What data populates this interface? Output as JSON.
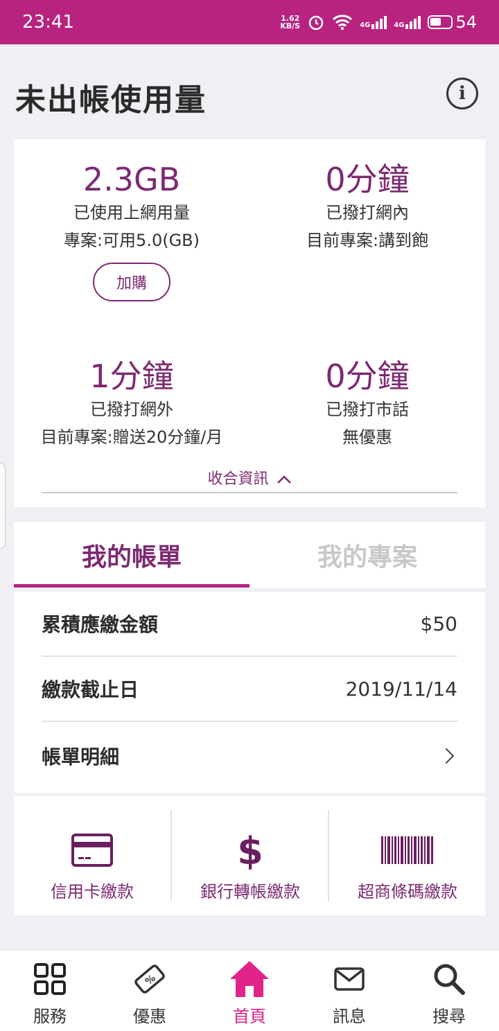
{
  "status_bar": {
    "time": "23:41",
    "net_speed_value": "1.62",
    "net_speed_unit": "KB/S",
    "signal1": "4G",
    "signal2": "4G",
    "battery": "54"
  },
  "page": {
    "title": "未出帳使用量"
  },
  "usage": {
    "data": {
      "amount": "2.3GB",
      "label": "已使用上網用量",
      "plan": "專案:可用5.0(GB)",
      "addon_button": "加購"
    },
    "onnet": {
      "amount": "0分鐘",
      "label": "已撥打網內",
      "plan": "目前專案:講到飽"
    },
    "offnet": {
      "amount": "1分鐘",
      "label": "已撥打網外",
      "plan": "目前專案:贈送20分鐘/月"
    },
    "landline": {
      "amount": "0分鐘",
      "label": "已撥打市話",
      "plan": "無優惠"
    },
    "collapse_label": "收合資訊"
  },
  "tabs": [
    {
      "label": "我的帳單",
      "active": true
    },
    {
      "label": "我的專案",
      "active": false
    }
  ],
  "bill": {
    "rows": [
      {
        "label": "累積應繳金額",
        "value": "$50"
      },
      {
        "label": "繳款截止日",
        "value": "2019/11/14"
      },
      {
        "label": "帳單明細",
        "value": ""
      }
    ]
  },
  "payment": [
    {
      "label": "信用卡繳款",
      "icon": "credit-card-icon"
    },
    {
      "label": "銀行轉帳繳款",
      "icon": "dollar-icon"
    },
    {
      "label": "超商條碼繳款",
      "icon": "barcode-icon"
    }
  ],
  "bottom_nav": [
    {
      "label": "服務",
      "icon": "grid-icon"
    },
    {
      "label": "優惠",
      "icon": "coupon-icon"
    },
    {
      "label": "首頁",
      "icon": "home-icon",
      "active": true
    },
    {
      "label": "訊息",
      "icon": "mail-icon"
    },
    {
      "label": "搜尋",
      "icon": "search-icon"
    }
  ],
  "colors": {
    "brand": "#b8237f",
    "accent": "#7c2a71",
    "active_nav": "#e0248a"
  }
}
